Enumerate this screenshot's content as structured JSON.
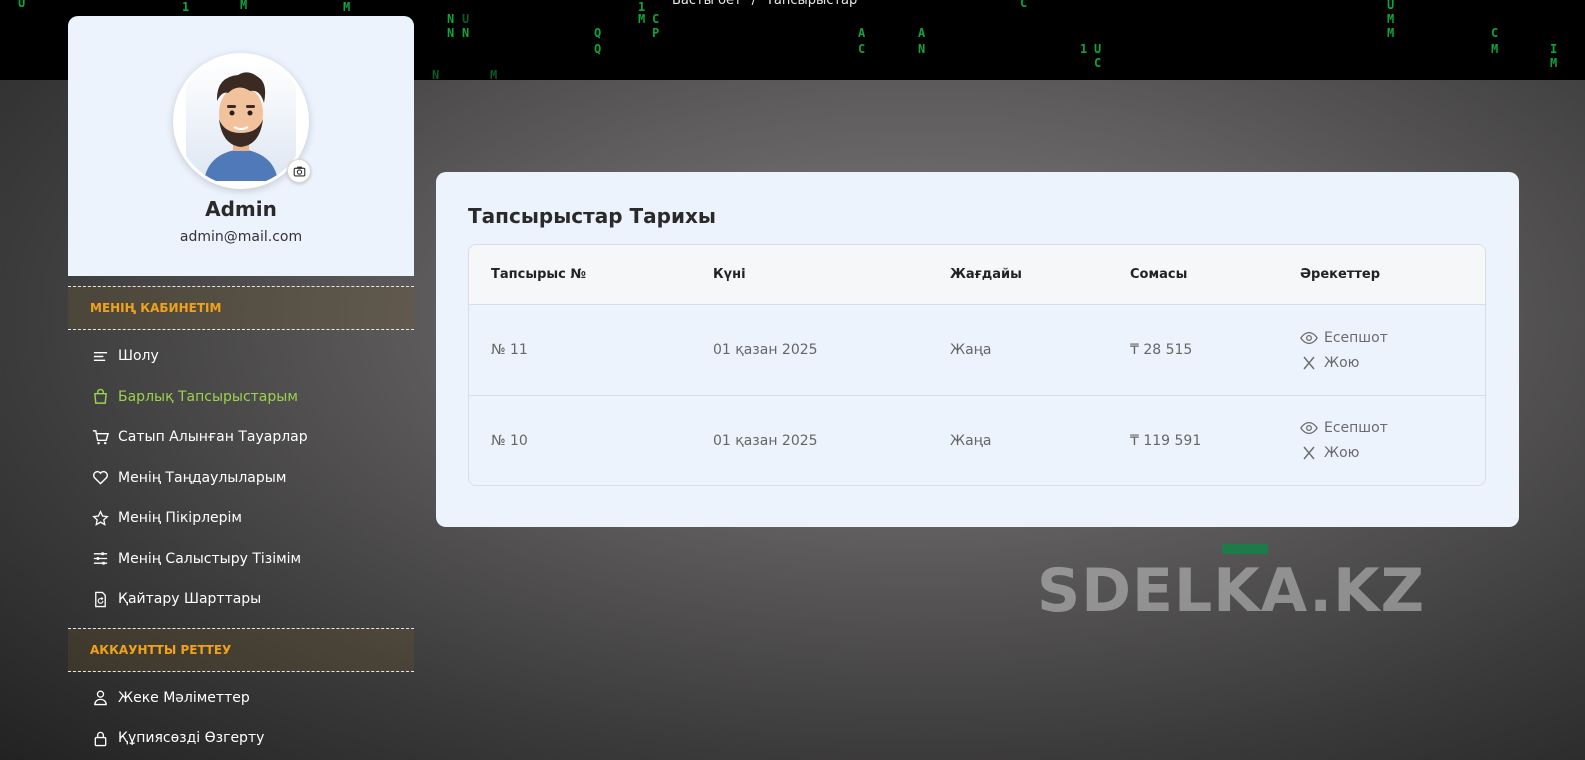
{
  "breadcrumb": {
    "home": "Басты бет",
    "current": "Тапсырыстар"
  },
  "profile": {
    "name": "Admin",
    "email": "admin@mail.com"
  },
  "sidebar": {
    "section1": "МЕНІҢ КАБИНЕТІМ",
    "items1": [
      {
        "label": "Шолу",
        "icon": "list-icon"
      },
      {
        "label": "Барлық Тапсырыстарым",
        "icon": "shopping-bag-icon",
        "active": true
      },
      {
        "label": "Сатып Алынған Тауарлар",
        "icon": "cart-icon"
      },
      {
        "label": "Менің Таңдаулыларым",
        "icon": "heart-icon"
      },
      {
        "label": "Менің Пікірлерім",
        "icon": "star-icon"
      },
      {
        "label": "Менің Салыстыру Тізімім",
        "icon": "sliders-icon"
      },
      {
        "label": "Қайтару Шарттары",
        "icon": "return-doc-icon"
      }
    ],
    "section2": "АККАУНТТЫ РЕТТЕУ",
    "items2": [
      {
        "label": "Жеке Мәліметтер",
        "icon": "user-icon"
      },
      {
        "label": "Құпиясөзді Өзгерту",
        "icon": "lock-icon"
      }
    ]
  },
  "orders": {
    "title": "Тапсырыстар Тарихы",
    "columns": [
      "Тапсырыс №",
      "Күні",
      "Жағдайы",
      "Сомасы",
      "Әрекеттер"
    ],
    "rows": [
      {
        "number": "№ 11",
        "date": "01 қазан 2025",
        "status": "Жаңа",
        "amount": "₸ 28 515",
        "invoice": "Есепшот",
        "delete": "Жою"
      },
      {
        "number": "№ 10",
        "date": "01 қазан 2025",
        "status": "Жаңа",
        "amount": "₸ 119 591",
        "invoice": "Есепшот",
        "delete": "Жою"
      }
    ]
  },
  "watermark": "SDELKA.KZ",
  "colors": {
    "accent": "#f0a31a",
    "active": "#9bd34a",
    "status": "#2469b3",
    "card": "#edf3fd"
  }
}
